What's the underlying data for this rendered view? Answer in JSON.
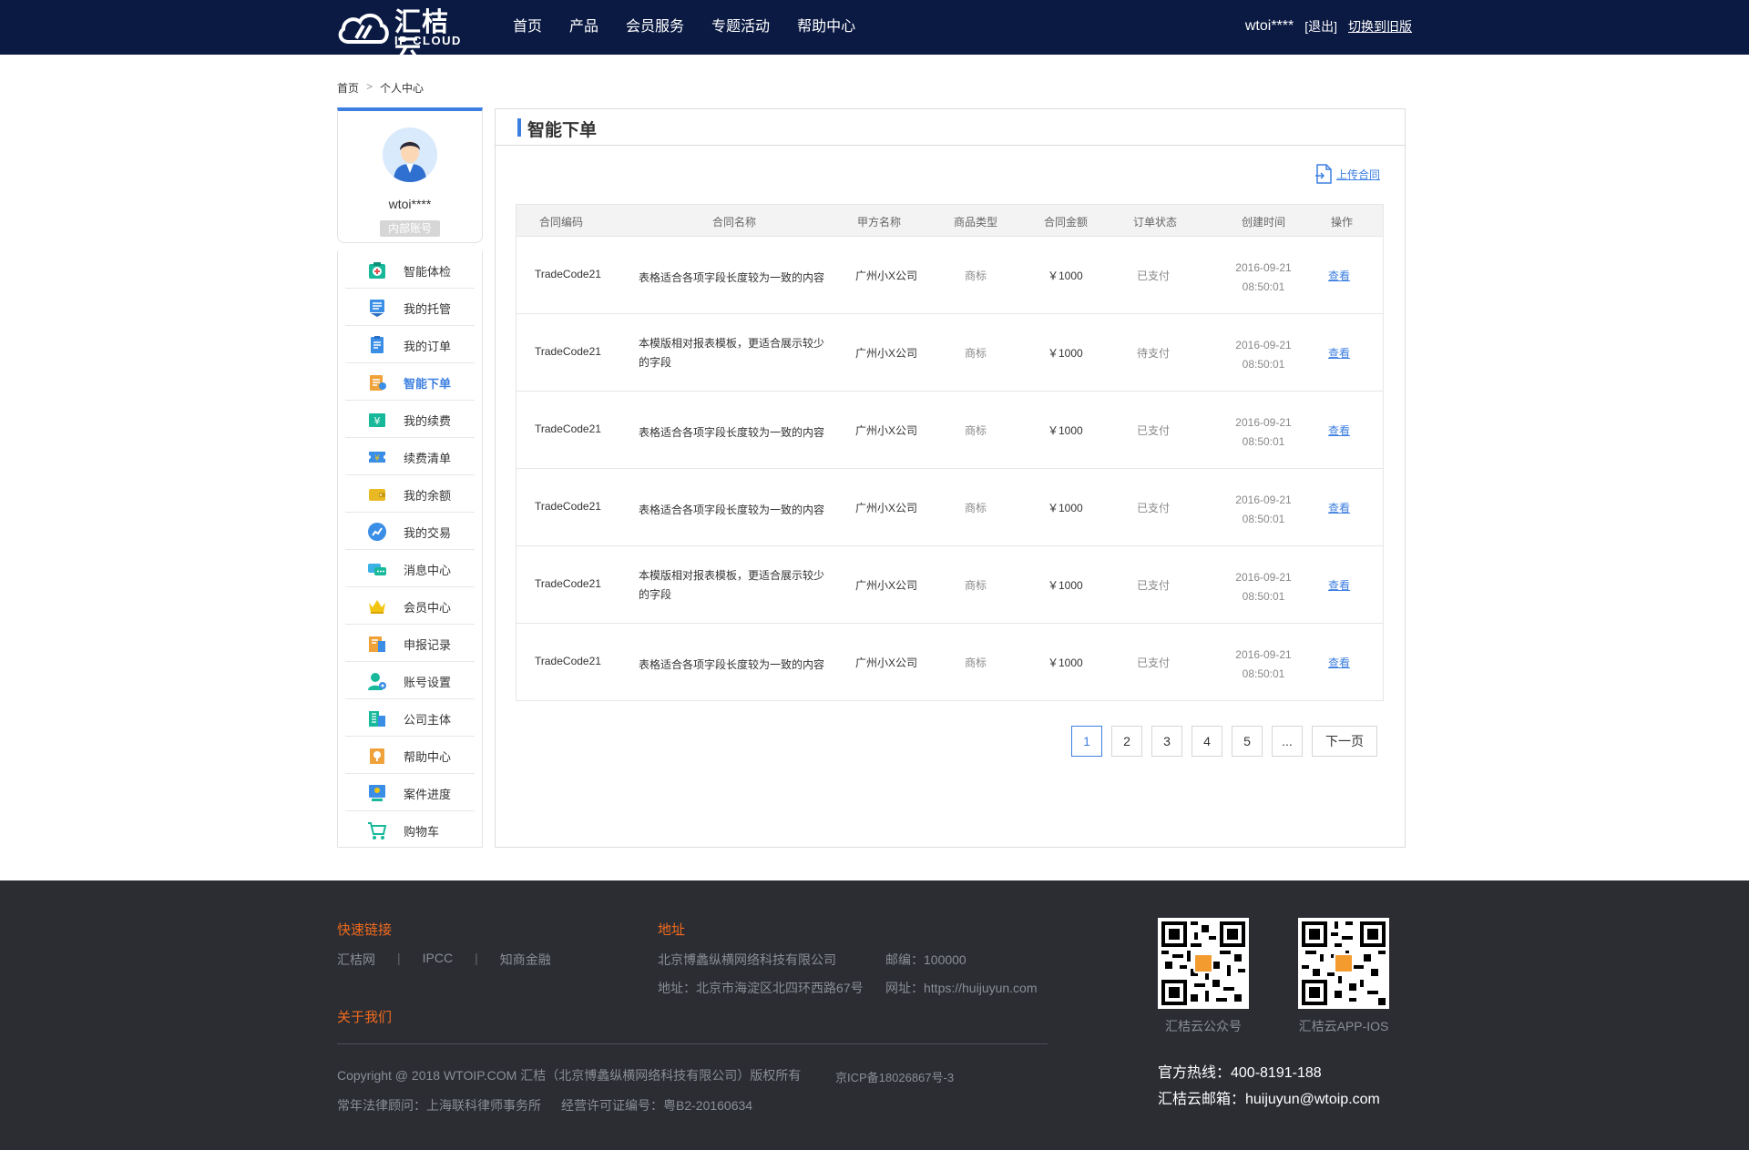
{
  "header": {
    "logo_cn": "汇桔云",
    "logo_en": "IP CLOUD",
    "nav": [
      "首页",
      "产品",
      "会员服务",
      "专题活动",
      "帮助中心"
    ],
    "username": "wtoi****",
    "logout": "[退出]",
    "switch_old": "切换到旧版"
  },
  "breadcrumb": {
    "home": "首页",
    "sep": ">",
    "current": "个人中心"
  },
  "profile": {
    "name": "wtoi****",
    "badge": "内部账号"
  },
  "sidebar": {
    "items": [
      {
        "label": "智能体检",
        "icon": "health-check-icon",
        "color": "#17b99a"
      },
      {
        "label": "我的托管",
        "icon": "hosting-icon",
        "color": "#3a8ee6"
      },
      {
        "label": "我的订单",
        "icon": "order-icon",
        "color": "#3a8ee6"
      },
      {
        "label": "智能下单",
        "icon": "smart-order-icon",
        "color": "#f0a23a",
        "active": true
      },
      {
        "label": "我的续费",
        "icon": "renewal-icon",
        "color": "#17b99a"
      },
      {
        "label": "续费清单",
        "icon": "renewal-list-icon",
        "color": "#3a8ee6"
      },
      {
        "label": "我的余额",
        "icon": "balance-icon",
        "color": "#e8b923"
      },
      {
        "label": "我的交易",
        "icon": "trade-icon",
        "color": "#3a8ee6"
      },
      {
        "label": "消息中心",
        "icon": "message-icon",
        "color": "#3ab0e6"
      },
      {
        "label": "会员中心",
        "icon": "crown-icon",
        "color": "#f2c511"
      },
      {
        "label": "申报记录",
        "icon": "record-icon",
        "color": "#f0a23a"
      },
      {
        "label": "账号设置",
        "icon": "account-settings-icon",
        "color": "#17b99a"
      },
      {
        "label": "公司主体",
        "icon": "company-icon",
        "color": "#17b99a"
      },
      {
        "label": "帮助中心",
        "icon": "help-icon",
        "color": "#f0a23a"
      },
      {
        "label": "案件进度",
        "icon": "case-progress-icon",
        "color": "#3a8ee6"
      },
      {
        "label": "购物车",
        "icon": "cart-icon",
        "color": "#17b99a"
      }
    ]
  },
  "main": {
    "title": "智能下单",
    "upload_label": "上传合同",
    "columns": [
      "合同编码",
      "合同名称",
      "甲方名称",
      "商品类型",
      "合同金额",
      "订单状态",
      "创建时间",
      "操作"
    ],
    "rows": [
      {
        "code": "TradeCode21",
        "name": "表格适合各项字段长度较为一致的内容",
        "party": "广州小X公司",
        "type": "商标",
        "amount": "￥1000",
        "status": "已支付",
        "date": "2016-09-21",
        "time": "08:50:01",
        "op": "查看"
      },
      {
        "code": "TradeCode21",
        "name": "本模版相对报表模板，更适合展示较少的字段",
        "party": "广州小X公司",
        "type": "商标",
        "amount": "￥1000",
        "status": "待支付",
        "date": "2016-09-21",
        "time": "08:50:01",
        "op": "查看"
      },
      {
        "code": "TradeCode21",
        "name": "表格适合各项字段长度较为一致的内容",
        "party": "广州小X公司",
        "type": "商标",
        "amount": "￥1000",
        "status": "已支付",
        "date": "2016-09-21",
        "time": "08:50:01",
        "op": "查看"
      },
      {
        "code": "TradeCode21",
        "name": "表格适合各项字段长度较为一致的内容",
        "party": "广州小X公司",
        "type": "商标",
        "amount": "￥1000",
        "status": "已支付",
        "date": "2016-09-21",
        "time": "08:50:01",
        "op": "查看"
      },
      {
        "code": "TradeCode21",
        "name": "本模版相对报表模板，更适合展示较少的字段",
        "party": "广州小X公司",
        "type": "商标",
        "amount": "￥1000",
        "status": "已支付",
        "date": "2016-09-21",
        "time": "08:50:01",
        "op": "查看"
      },
      {
        "code": "TradeCode21",
        "name": "表格适合各项字段长度较为一致的内容",
        "party": "广州小X公司",
        "type": "商标",
        "amount": "￥1000",
        "status": "已支付",
        "date": "2016-09-21",
        "time": "08:50:01",
        "op": "查看"
      }
    ],
    "pagination": {
      "pages": [
        "1",
        "2",
        "3",
        "4",
        "5",
        "..."
      ],
      "current": "1",
      "next": "下一页"
    }
  },
  "footer": {
    "quick_links_title": "快速链接",
    "quick_links": [
      "汇桔网",
      "IPCC",
      "知商金融"
    ],
    "link_sep": "|",
    "address_title": "地址",
    "company": "北京博蠡纵横网络科技有限公司",
    "postcode": "邮编：100000",
    "address": "地址：北京市海淀区北四环西路67号",
    "website": "网址：https://huijuyun.com",
    "about_title": "关于我们",
    "copyright": "Copyright @ 2018 WTOIP.COM 汇桔（北京博蠡纵横网络科技有限公司）版权所有",
    "icp": "京ICP备18026867号-3",
    "lawyer": "常年法律顾问：上海联科律师事务所",
    "license": "经营许可证编号：粤B2-20160634",
    "qr1_caption": "汇桔云公众号",
    "qr2_caption": "汇桔云APP-IOS",
    "hotline": "官方热线：400-8191-188",
    "email": "汇桔云邮箱：huijuyun@wtoip.com"
  },
  "colors": {
    "header_bg": "#0b1a43",
    "accent": "#3d7fe0",
    "footer_bg": "#2b2d33",
    "footer_title": "#f26b1d"
  }
}
